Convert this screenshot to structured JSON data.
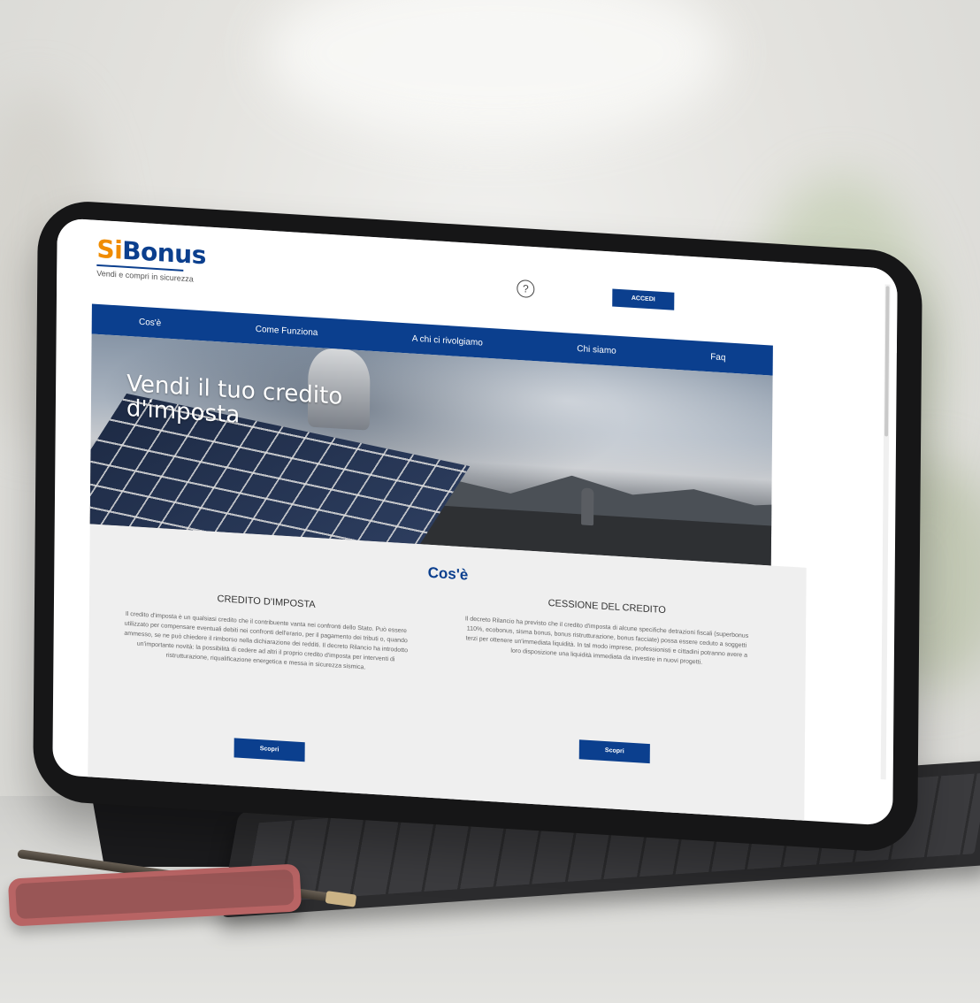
{
  "site": {
    "logo": {
      "si": "Si",
      "bonus": "Bonus",
      "tagline": "Vendi e compri in sicurezza"
    },
    "help_icon": "question-circle-icon",
    "login_label": "ACCEDI",
    "nav": [
      "Cos'è",
      "Come Funziona",
      "A chi ci rivolgiamo",
      "Chi siamo",
      "Faq"
    ],
    "hero_title_line1": "Vendi il tuo credito",
    "hero_title_line2": "d'imposta",
    "section_title": "Cos'è",
    "columns": [
      {
        "title": "CREDITO D'IMPOSTA",
        "text": "Il credito d'imposta è un qualsiasi credito che il contribuente vanta nei confronti dello Stato. Può essere utilizzato per compensare eventuali debiti nei confronti dell'erario, per il pagamento dei tributi o, quando ammesso, se ne può chiedere il rimborso nella dichiarazione dei redditi. Il decreto Rilancio ha introdotto un'importante novità: la possibilità di cedere ad altri il proprio credito d'imposta per interventi di ristrutturazione, riqualificazione energetica e messa in sicurezza sismica.",
        "button": "Scopri"
      },
      {
        "title": "CESSIONE DEL CREDITO",
        "text": "Il decreto Rilancio ha previsto che il credito d'imposta di alcune specifiche detrazioni fiscali (superbonus 110%, ecobonus, sisma bonus, bonus ristrutturazione, bonus facciate) possa essere ceduto a soggetti terzi per ottenere un'immediata liquidità. In tal modo imprese, professionisti e cittadini potranno avere a loro disposizione una liquidità immediata da investire in nuovi progetti.",
        "button": "Scopri"
      }
    ]
  },
  "colors": {
    "brand_blue": "#0b3f8e",
    "brand_orange": "#f08c00"
  }
}
